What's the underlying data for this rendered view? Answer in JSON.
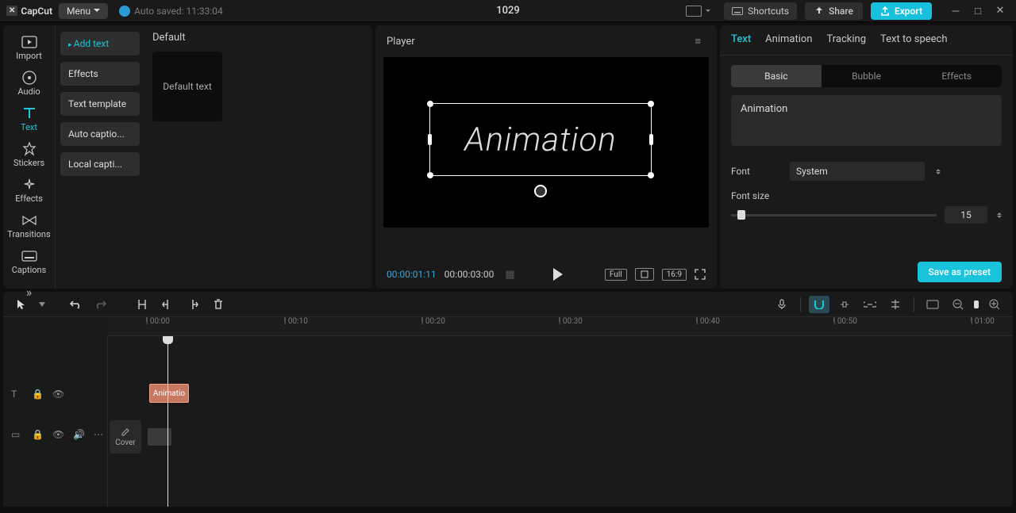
{
  "app_name": "CapCut",
  "menu_label": "Menu",
  "autosave": "Auto saved: 11:33:04",
  "project_title": "1029",
  "shortcuts_label": "Shortcuts",
  "share_label": "Share",
  "export_label": "Export",
  "media_tabs": {
    "import": "Import",
    "audio": "Audio",
    "text": "Text",
    "stickers": "Stickers",
    "effects": "Effects",
    "transitions": "Transitions",
    "captions": "Captions"
  },
  "text_sidebar": {
    "add_text": "Add text",
    "effects": "Effects",
    "text_template": "Text template",
    "auto_captions": "Auto captio...",
    "local_captions": "Local capti..."
  },
  "text_panel": {
    "header": "Default",
    "card": "Default text"
  },
  "player": {
    "title": "Player",
    "canvas_text": "Animation",
    "time_current": "00:00:01:11",
    "time_duration": "00:00:03:00",
    "full": "Full",
    "ratio": "16:9"
  },
  "inspector": {
    "tabs": {
      "text": "Text",
      "animation": "Animation",
      "tracking": "Tracking",
      "tts": "Text to speech"
    },
    "sub": {
      "basic": "Basic",
      "bubble": "Bubble",
      "effects": "Effects"
    },
    "text_value": "Animation",
    "font_label": "Font",
    "font_value": "System",
    "size_label": "Font size",
    "size_value": "15",
    "save_preset": "Save as preset"
  },
  "timeline": {
    "ticks": [
      "00:00",
      "00:10",
      "00:20",
      "00:30",
      "00:40",
      "00:50",
      "01:00"
    ],
    "text_clip": "Animatio",
    "cover": "Cover"
  }
}
